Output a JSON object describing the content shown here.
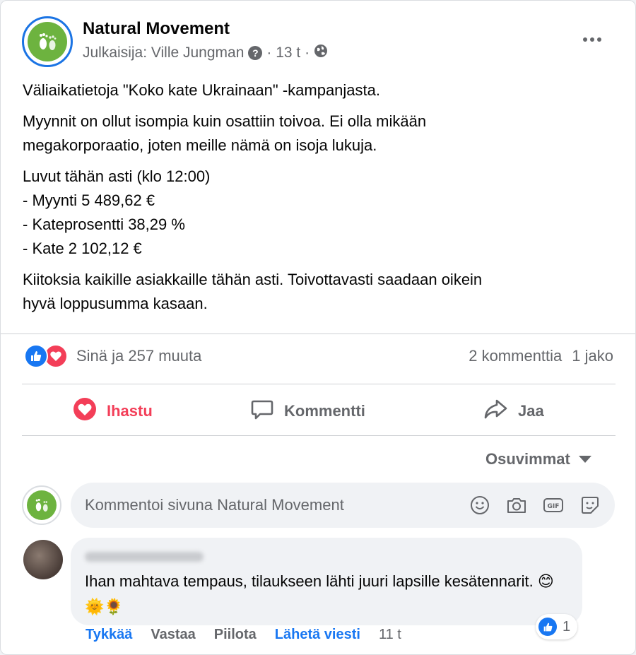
{
  "post": {
    "page_name": "Natural Movement",
    "meta_author": "Julkaisija: Ville Jungman",
    "meta_time": "· 13 t ·",
    "paragraphs": {
      "p1": "Väliaikatietoja \"Koko kate Ukrainaan\" -kampanjasta.",
      "p2_line1": "Myynnit on ollut isompia kuin osattiin toivoa. Ei olla mikään",
      "p2_line2": "megakorporaatio, joten meille nämä on isoja lukuja.",
      "p3_line1": "Luvut tähän asti (klo 12:00)",
      "p3_line2": "- Myynti 5 489,62 €",
      "p3_line3": "- Kateprosentti 38,29 %",
      "p3_line4": "- Kate 2 102,12 €",
      "p4_line1": "Kiitoksia kaikille asiakkaille tähän asti. Toivottavasti saadaan oikein",
      "p4_line2": "hyvä loppusumma kasaan."
    }
  },
  "reactions": {
    "summary": "Sinä ja 257 muuta",
    "comments": "2 kommenttia",
    "shares": "1 jako"
  },
  "actions": {
    "love": "Ihastu",
    "comment": "Kommentti",
    "share": "Jaa"
  },
  "sort_label": "Osuvimmat",
  "comment_input": {
    "placeholder": "Kommentoi sivuna Natural Movement"
  },
  "comment": {
    "text": "Ihan mahtava tempaus, tilaukseen lähti juuri lapsille kesätennarit.",
    "emojis": "😊🌞🌻",
    "like_count": "1",
    "actions": {
      "like": "Tykkää",
      "reply": "Vastaa",
      "hide": "Piilota",
      "message": "Lähetä viesti",
      "time": "11 t"
    }
  },
  "colors": {
    "accent_blue": "#1877f2",
    "love_red": "#f33e58",
    "logo_green": "#6db33f",
    "secondary_text": "#65676b"
  }
}
